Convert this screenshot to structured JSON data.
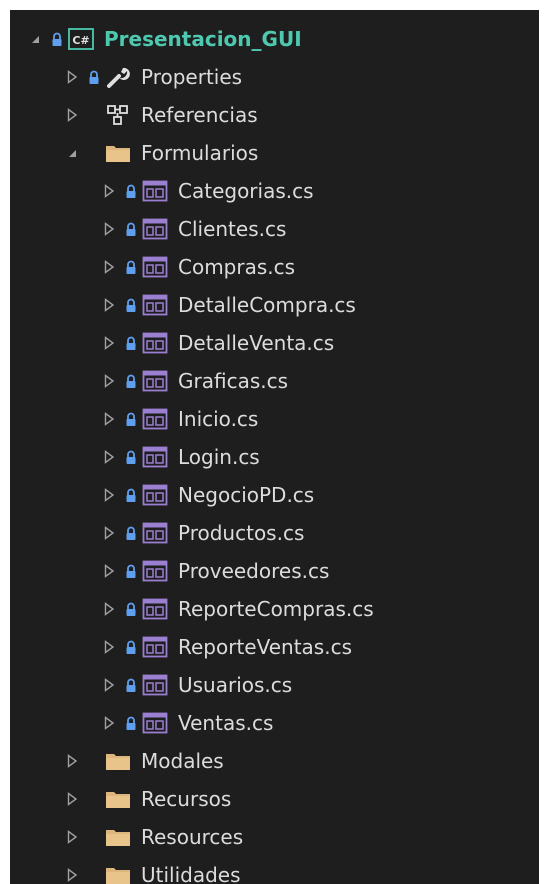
{
  "tree": {
    "root": {
      "label": "Presentacion_GUI",
      "icon": "csharp-project-icon"
    },
    "top_items": [
      {
        "label": "Properties",
        "icon": "wrench-icon"
      },
      {
        "label": "Referencias",
        "icon": "references-icon"
      },
      {
        "label": "Formularios",
        "icon": "folder-icon"
      }
    ],
    "form_files": [
      "Categorias.cs",
      "Clientes.cs",
      "Compras.cs",
      "DetalleCompra.cs",
      "DetalleVenta.cs",
      "Graficas.cs",
      "Inicio.cs",
      "Login.cs",
      "NegocioPD.cs",
      "Productos.cs",
      "Proveedores.cs",
      "ReporteCompras.cs",
      "ReporteVentas.cs",
      "Usuarios.cs",
      "Ventas.cs"
    ],
    "bottom_folders": [
      "Modales",
      "Recursos",
      "Resources",
      "Utilidades"
    ]
  },
  "colors": {
    "background": "#1e1e1e",
    "text": "#dcdcdc",
    "project_text": "#4ec9b0",
    "folder": "#dcb67a",
    "lock": "#5ea0ef",
    "form_icon": "#9b7fd1",
    "arrow": "#a0a0a0"
  }
}
